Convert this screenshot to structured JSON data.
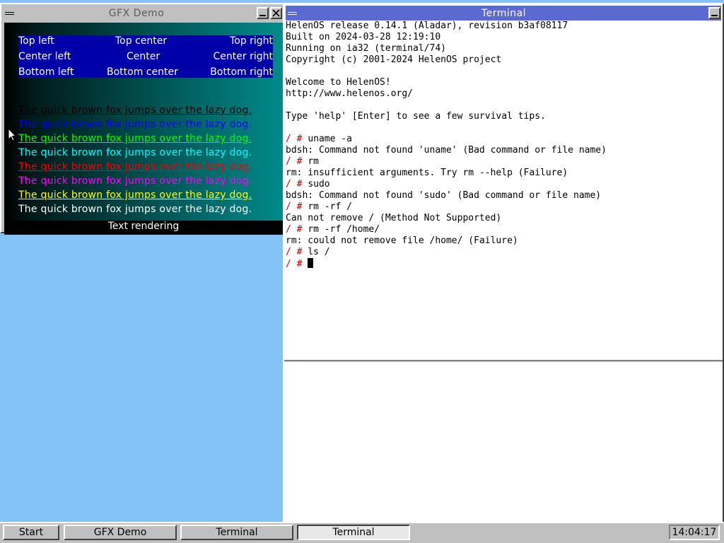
{
  "gfx": {
    "title": "GFX Demo",
    "alignment": {
      "top_left": "Top left",
      "top_center": "Top center",
      "top_right": "Top right",
      "center_left": "Center left",
      "center": "Center",
      "center_right": "Center right",
      "bottom_left": "Bottom left",
      "bottom_center": "Bottom center",
      "bottom_right": "Bottom right"
    },
    "sample_text": "The quick brown fox jumps over the lazy dog.",
    "sample_colors": [
      "#000000",
      "#0000ff",
      "#00ff00",
      "#00ffff",
      "#ff0000",
      "#ff00ff",
      "#ffff00",
      "#ffffff"
    ],
    "caption": "Text rendering"
  },
  "terminal": {
    "title": "Terminal",
    "lines": [
      {
        "text": "HelenOS release 0.14.1 (Aladar), revision b3af08117"
      },
      {
        "text": "Built on 2024-03-28 12:19:10"
      },
      {
        "text": "Running on ia32 (terminal/74)"
      },
      {
        "text": "Copyright (c) 2001-2024 HelenOS project"
      },
      {
        "text": ""
      },
      {
        "text": "Welcome to HelenOS!"
      },
      {
        "text": "http://www.helenos.org/"
      },
      {
        "text": ""
      },
      {
        "text": "Type 'help' [Enter] to see a few survival tips."
      },
      {
        "text": ""
      },
      {
        "prompt": "/ # ",
        "text": "uname -a"
      },
      {
        "text": "bdsh: Command not found 'uname' (Bad command or file name)"
      },
      {
        "prompt": "/ # ",
        "text": "rm"
      },
      {
        "text": "rm: insufficient arguments. Try rm --help (Failure)"
      },
      {
        "prompt": "/ # ",
        "text": "sudo"
      },
      {
        "text": "bdsh: Command not found 'sudo' (Bad command or file name)"
      },
      {
        "prompt": "/ # ",
        "text": "rm -rf /"
      },
      {
        "text": "Can not remove / (Method Not Supported)"
      },
      {
        "prompt": "/ # ",
        "text": "rm -rf /home/"
      },
      {
        "text": "rm: could not remove file /home/ (Failure)"
      },
      {
        "prompt": "/ # ",
        "text": "ls /"
      },
      {
        "prompt": "/ # ",
        "text": "",
        "cursor": true
      }
    ]
  },
  "taskbar": {
    "start_label": "Start",
    "tasks": [
      "GFX Demo",
      "Terminal",
      "Terminal"
    ],
    "clock": "14:04:17"
  },
  "colors": {
    "desktop": "#84c2f8",
    "terminal_title_bg": "#5a6ad0",
    "prompt": "#c00000",
    "alignment_box": "#0000a8"
  },
  "icons": [
    "window-menu-icon",
    "minimize-icon",
    "close-icon",
    "mouse-pointer-icon"
  ]
}
